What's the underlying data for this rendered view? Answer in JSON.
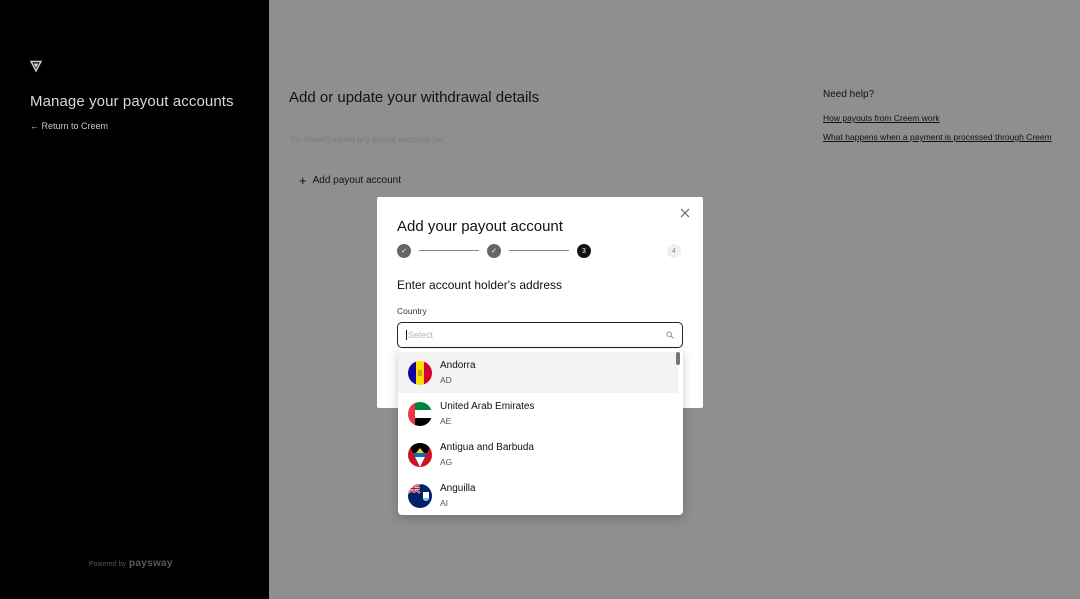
{
  "sidebar": {
    "title": "Manage your payout accounts",
    "return_link": "← Return to Creem",
    "powered_by": "Powered by",
    "powered_brand": "paysway"
  },
  "main": {
    "title": "Add or update your withdrawal details",
    "empty_text": "You haven't added any payout accounts yet",
    "add_account_label": "Add payout account",
    "help": {
      "title": "Need help?",
      "links": [
        "How payouts from Creem work",
        "What happens when a payment is processed through Creem"
      ]
    }
  },
  "modal": {
    "title": "Add your payout account",
    "steps": [
      {
        "label": "✓",
        "state": "done"
      },
      {
        "label": "✓",
        "state": "done"
      },
      {
        "label": "3",
        "state": "active"
      },
      {
        "label": "4",
        "state": "pending"
      }
    ],
    "section_title": "Enter account holder's address",
    "country_label": "Country",
    "country_placeholder": "Select",
    "country_value": ""
  },
  "dropdown": {
    "options": [
      {
        "name": "Andorra",
        "code": "AD",
        "flag": "andorra-flag-icon"
      },
      {
        "name": "United Arab Emirates",
        "code": "AE",
        "flag": "uae-flag-icon"
      },
      {
        "name": "Antigua and Barbuda",
        "code": "AG",
        "flag": "antigua-flag-icon"
      },
      {
        "name": "Anguilla",
        "code": "AI",
        "flag": "anguilla-flag-icon"
      }
    ]
  },
  "colors": {
    "sidebar_bg": "#000000",
    "overlay_bg": "#8f8f8f",
    "modal_bg": "#ffffff",
    "active_step": "#111111"
  }
}
